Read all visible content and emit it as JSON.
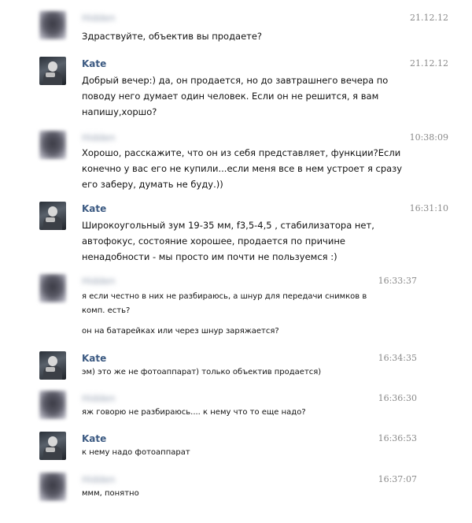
{
  "messages": [
    {
      "sender": "",
      "time": "21.12.12",
      "lines": [
        "Здраствуйте, объектив вы продаете?"
      ]
    },
    {
      "sender": "Kate",
      "time": "21.12.12",
      "lines": [
        "Добрый вечер:) да, он продается, но до завтрашнего вечера по",
        "поводу него думает один человек. Если он не решится, я вам",
        "напишу,хоршо?"
      ]
    },
    {
      "sender": "",
      "time": "10:38:09",
      "lines": [
        "Хорошо, расскажите, что он из себя представляет, функции?Если",
        "конечно у вас его не купили...если меня все в нем устроет я сразу",
        "его заберу, думать не буду.))"
      ]
    },
    {
      "sender": "Kate",
      "time": "16:31:10",
      "lines": [
        "Широкоугольный зум 19-35 мм, f3,5-4,5 , стабилизатора нет,",
        "автофокус, состояние хорошее, продается по причине",
        "ненадобности - мы просто им почти не пользуемся :)"
      ]
    },
    {
      "sender": "",
      "time": "16:33:37",
      "lines": [
        "я если честно в них не разбираюсь, а шнур для передачи снимков в",
        "комп. есть?"
      ],
      "extra": "он на батарейках или через шнур заряжается?"
    },
    {
      "sender": "Kate",
      "time": "16:34:35",
      "lines": [
        "эм) это же не фотоаппарат) только объектив продается)"
      ]
    },
    {
      "sender": "",
      "time": "16:36:30",
      "lines": [
        "яж говорю не разбираюсь.... к нему что то еще надо?"
      ]
    },
    {
      "sender": "Kate",
      "time": "16:36:53",
      "lines": [
        "к нему надо фотоаппарат"
      ]
    },
    {
      "sender": "",
      "time": "16:37:07",
      "lines": [
        "ммм, понятно"
      ]
    }
  ],
  "blurred_name_placeholder": "Hidden"
}
